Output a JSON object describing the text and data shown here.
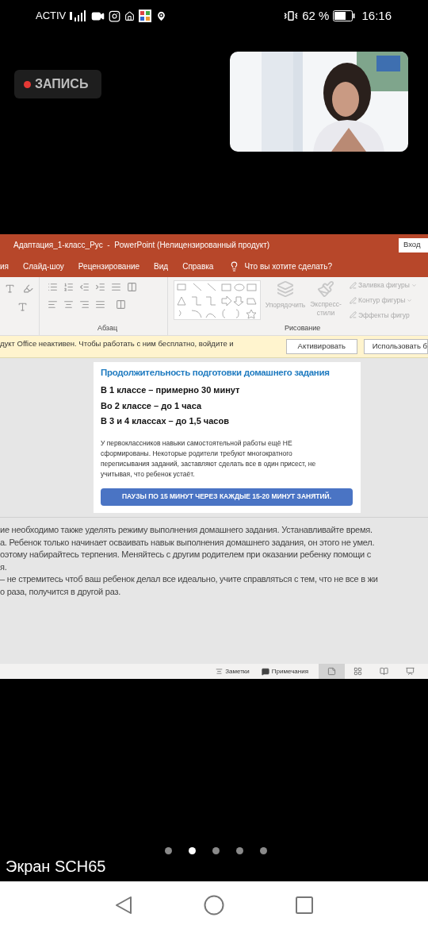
{
  "status_bar": {
    "carrier": "ACTIV",
    "battery": "62 %",
    "time": "16:16"
  },
  "recording_badge": {
    "label": "ЗАПИСЬ"
  },
  "powerpoint": {
    "title": "Адаптация_1-класс_Рус  -  PowerPoint (Нелицензированный продукт)",
    "sign_in": "Вход",
    "tabs": [
      {
        "label": "ия"
      },
      {
        "label": "Слайд-шоу"
      },
      {
        "label": "Рецензирование"
      },
      {
        "label": "Вид"
      },
      {
        "label": "Справка"
      }
    ],
    "tell_me": "Что вы хотите сделать?",
    "ribbon": {
      "paragraph_group": "Абзац",
      "drawing_group": "Рисование",
      "arrange": "Упорядочить",
      "quick_styles": "Экспресс-стили",
      "shape_commands": [
        {
          "label": "Заливка фигуры",
          "caret": true
        },
        {
          "label": "Контур фигуры",
          "caret": true
        },
        {
          "label": "Эффекты фигур",
          "caret": false
        }
      ]
    },
    "notification": {
      "message": "дукт Office неактивен. Чтобы работать с ним бесплатно, войдите и",
      "buttons": [
        "Активировать",
        "Использовать б"
      ]
    },
    "slide": {
      "title": "Продолжительность подготовки домашнего задания",
      "items": [
        "В 1 классе – примерно 30 минут",
        "Во 2 классе – до 1 часа",
        "В 3 и 4 классах – до 1,5 часов"
      ],
      "paragraph": "У первоклассников навыки самостоятельной работы ещё НЕ сформированы. Некоторые родители требуют многократного переписывания заданий, заставляют сделать все в один присест, не учитывая, что ребенок устаёт.",
      "banner": "ПАУЗЫ ПО 15 МИНУТ ЧЕРЕЗ КАЖДЫЕ 15-20 МИНУТ ЗАНЯТИЙ."
    },
    "notes": [
      "ие необходимо также уделять режиму выполнения домашнего задания. Устанавливайте время.",
      "а. Ребенок только начинает осваивать навык выполнения домашнего задания, он этого не умел.",
      "оэтому набирайтесь терпения. Меняйтесь с другим родителем при оказании ребенку помощи с",
      "я.",
      "– не стремитесь чтоб ваш ребенок делал все идеально, учите справляться с тем, что не все в жи",
      "о раза, получится в другой раз."
    ],
    "status": {
      "notes_button": "Заметки",
      "comments_button": "Примечания",
      "views": [
        {
          "kind": "normal",
          "selected": true
        },
        {
          "kind": "sorter",
          "selected": false
        },
        {
          "kind": "reading",
          "selected": false
        },
        {
          "kind": "slideshow",
          "selected": false
        }
      ]
    }
  },
  "page_dots": [
    {
      "selected": false
    },
    {
      "selected": true
    },
    {
      "selected": false
    },
    {
      "selected": false
    },
    {
      "selected": false
    }
  ],
  "screen_label": "Экран SCH65"
}
